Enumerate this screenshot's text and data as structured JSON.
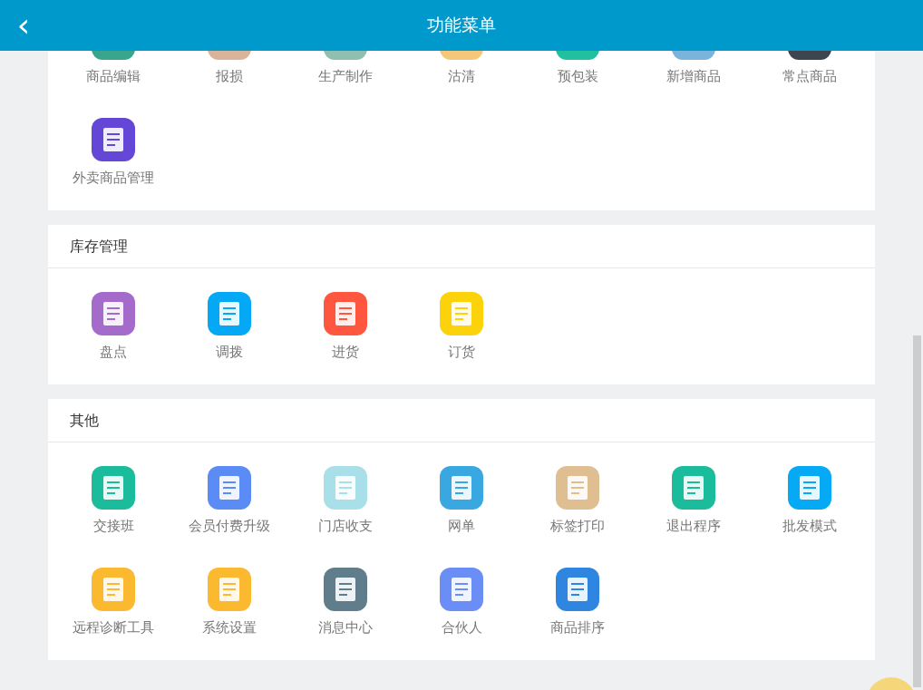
{
  "header": {
    "back": "‹",
    "title": "功能菜单"
  },
  "sections": [
    {
      "items": [
        {
          "label": "商品编辑",
          "color": "#3aa58f"
        },
        {
          "label": "报损",
          "color": "#d9b39a"
        },
        {
          "label": "生产制作",
          "color": "#8fbfb0"
        },
        {
          "label": "沽清",
          "color": "#f5c77a"
        },
        {
          "label": "预包装",
          "color": "#20c0a0"
        },
        {
          "label": "新增商品",
          "color": "#7ab3dc"
        },
        {
          "label": "常点商品",
          "color": "#3d4650"
        },
        {
          "label": "外卖商品管理",
          "color": "#6447d6"
        }
      ]
    },
    {
      "title": "库存管理",
      "items": [
        {
          "label": "盘点",
          "color": "#a56bcb"
        },
        {
          "label": "调拨",
          "color": "#04a8f4"
        },
        {
          "label": "进货",
          "color": "#ff5640"
        },
        {
          "label": "订货",
          "color": "#fcd20a"
        }
      ]
    },
    {
      "title": "其他",
      "items": [
        {
          "label": "交接班",
          "color": "#1abc9c"
        },
        {
          "label": "会员付费升级",
          "color": "#5b8cf5"
        },
        {
          "label": "门店收支",
          "color": "#a8dfe8"
        },
        {
          "label": "网单",
          "color": "#3aa8e0"
        },
        {
          "label": "标签打印",
          "color": "#dfbf92"
        },
        {
          "label": "退出程序",
          "color": "#1abc9c"
        },
        {
          "label": "批发模式",
          "color": "#06a9f4"
        },
        {
          "label": "远程诊断工具",
          "color": "#fbb930"
        },
        {
          "label": "系统设置",
          "color": "#fbb930"
        },
        {
          "label": "消息中心",
          "color": "#607d8b"
        },
        {
          "label": "合伙人",
          "color": "#6a8ef5"
        },
        {
          "label": "商品排序",
          "color": "#2f86e0"
        }
      ]
    }
  ]
}
